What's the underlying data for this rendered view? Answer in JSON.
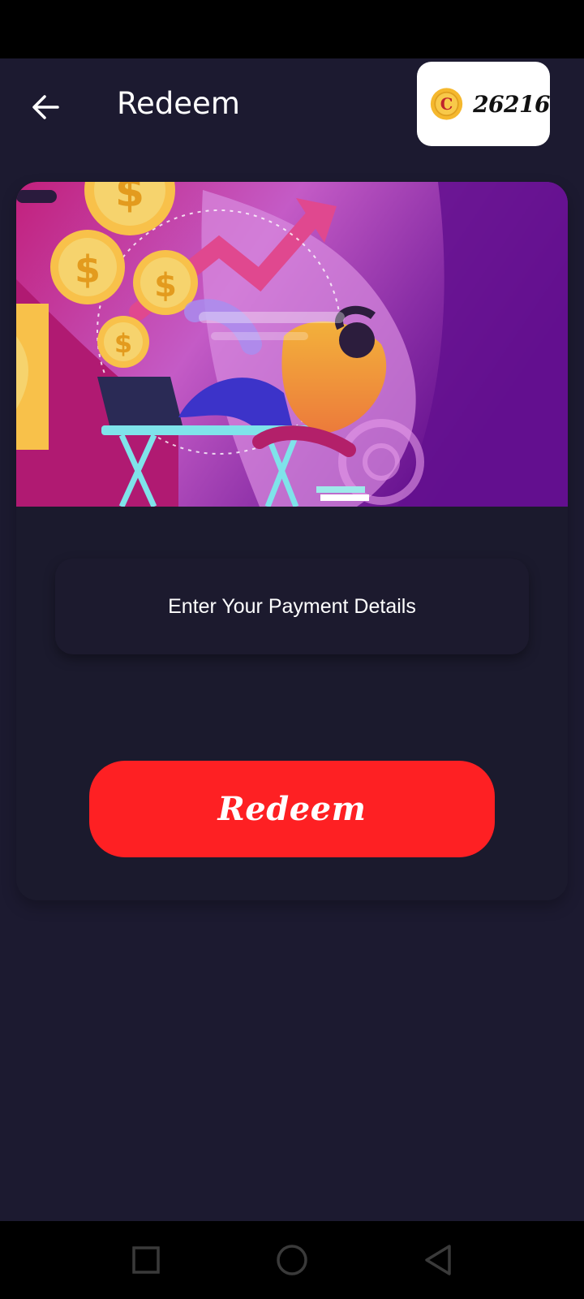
{
  "header": {
    "title": "Redeem",
    "back_icon": "arrow-left-icon"
  },
  "wallet": {
    "coin_icon": "coin-icon",
    "coin_letter": "C",
    "balance": "26216"
  },
  "banner": {
    "image": "redeem-illustration"
  },
  "form": {
    "payment_prompt": "Enter Your Payment Details"
  },
  "actions": {
    "redeem_label": "Redeem"
  },
  "nav": {
    "recents_icon": "square-icon",
    "home_icon": "circle-icon",
    "back_icon": "triangle-back-icon"
  },
  "colors": {
    "background": "#1c1a30",
    "accent": "#fe2023",
    "coin": "#f5b82e"
  }
}
